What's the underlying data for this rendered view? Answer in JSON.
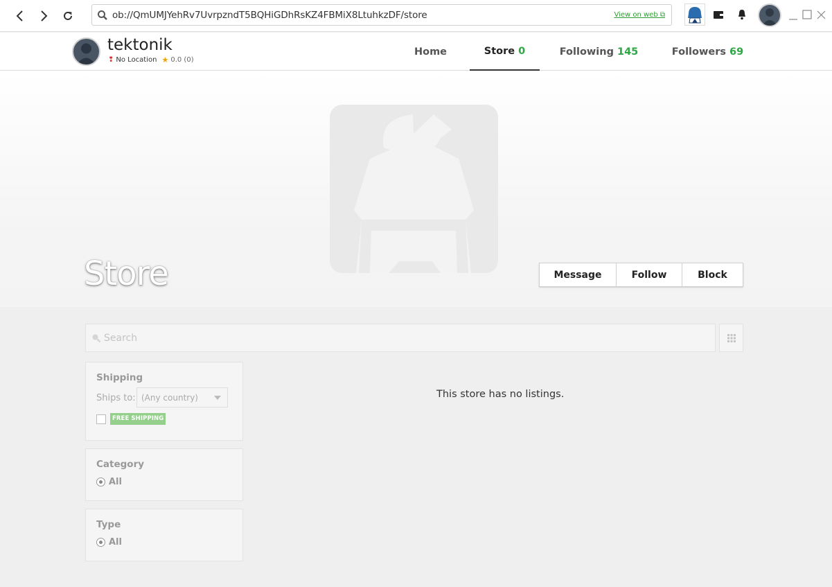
{
  "browser": {
    "url": "ob://QmUMJYehRv7UvrpzndT5BQHiGDhRsKZ4FBMiX8LtuhkzDF/store",
    "view_on_web": "View on web"
  },
  "profile": {
    "name": "tektonik",
    "location": "No Location",
    "rating": "0.0 (0)"
  },
  "tabs": [
    {
      "label": "Home",
      "count": ""
    },
    {
      "label": "Store",
      "count": "0"
    },
    {
      "label": "Following",
      "count": "145"
    },
    {
      "label": "Followers",
      "count": "69"
    }
  ],
  "banner": {
    "title": "Store",
    "buttons": {
      "message": "Message",
      "follow": "Follow",
      "block": "Block"
    }
  },
  "search": {
    "placeholder": "Search"
  },
  "filters": {
    "shipping": {
      "title": "Shipping",
      "ships_to_label": "Ships to:",
      "ships_to_value": "(Any country)",
      "free_shipping": "FREE SHIPPING"
    },
    "category": {
      "title": "Category",
      "option": "All"
    },
    "type": {
      "title": "Type",
      "option": "All"
    }
  },
  "empty_message": "This store has no listings.",
  "colors": {
    "accent_green": "#2ea744",
    "free_shipping_bg": "#94cf8c"
  }
}
